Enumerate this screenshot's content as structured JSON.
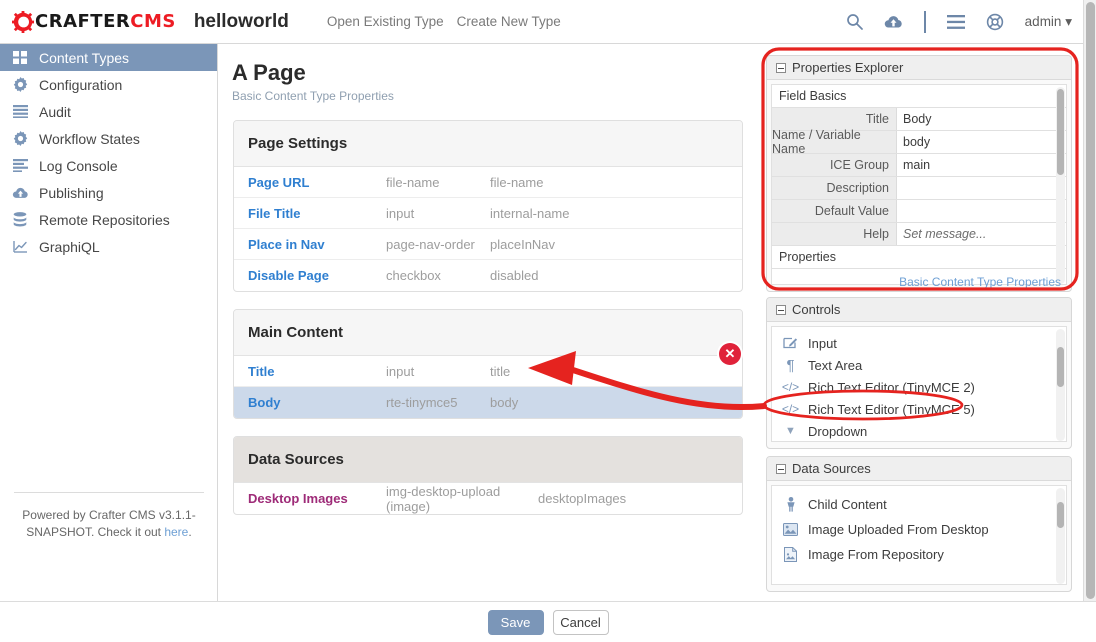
{
  "header": {
    "logo_text_1": "CRAFTER",
    "logo_text_2": "CMS",
    "site_name": "helloworld",
    "links": [
      {
        "label": "Open Existing Type"
      },
      {
        "label": "Create New Type"
      }
    ],
    "icons": [
      "search-icon",
      "cloud-upload-icon",
      "hamburger-menu-icon",
      "help-globe-icon"
    ],
    "user_menu": "admin"
  },
  "sidebar": {
    "items": [
      {
        "label": "Content Types",
        "icon": "grid-icon",
        "active": true
      },
      {
        "label": "Configuration",
        "icon": "gear-icon",
        "active": false
      },
      {
        "label": "Audit",
        "icon": "lines-icon",
        "active": false
      },
      {
        "label": "Workflow States",
        "icon": "gear-icon",
        "active": false
      },
      {
        "label": "Log Console",
        "icon": "log-lines-icon",
        "active": false
      },
      {
        "label": "Publishing",
        "icon": "cloud-upload-icon",
        "active": false
      },
      {
        "label": "Remote Repositories",
        "icon": "database-icon",
        "active": false
      },
      {
        "label": "GraphiQL",
        "icon": "chart-line-icon",
        "active": false
      }
    ],
    "footer": {
      "text_1": "Powered by Crafter CMS v3.1.1-SNAPSHOT. Check it out ",
      "link": "here",
      "text_2": "."
    }
  },
  "main": {
    "title": "A Page",
    "subtitle": "Basic Content Type Properties",
    "sections": [
      {
        "heading": "Page Settings",
        "style": "light",
        "rows": [
          {
            "name": "Page URL",
            "type": "file-name",
            "variable": "file-name",
            "selected": false,
            "color": "blue"
          },
          {
            "name": "File Title",
            "type": "input",
            "variable": "internal-name",
            "selected": false,
            "color": "blue"
          },
          {
            "name": "Place in Nav",
            "type": "page-nav-order",
            "variable": "placeInNav",
            "selected": false,
            "color": "blue"
          },
          {
            "name": "Disable Page",
            "type": "checkbox",
            "variable": "disabled",
            "selected": false,
            "color": "blue"
          }
        ]
      },
      {
        "heading": "Main Content",
        "style": "light",
        "rows": [
          {
            "name": "Title",
            "type": "input",
            "variable": "title",
            "selected": false,
            "color": "blue"
          },
          {
            "name": "Body",
            "type": "rte-tinymce5",
            "variable": "body",
            "selected": true,
            "color": "blue"
          }
        ]
      },
      {
        "heading": "Data Sources",
        "style": "alt",
        "rows": [
          {
            "name": "Desktop Images",
            "type": "img-desktop-upload (image)",
            "variable": "desktopImages",
            "selected": false,
            "color": "purple"
          }
        ]
      }
    ]
  },
  "right": {
    "properties_explorer": {
      "title": "Properties Explorer",
      "section_1": "Field Basics",
      "fields": [
        {
          "key": "Title",
          "value": "Body",
          "placeholder": false
        },
        {
          "key": "Name / Variable Name",
          "value": "body",
          "placeholder": false
        },
        {
          "key": "ICE Group",
          "value": "main",
          "placeholder": false
        },
        {
          "key": "Description",
          "value": "",
          "placeholder": false
        },
        {
          "key": "Default Value",
          "value": "",
          "placeholder": false
        },
        {
          "key": "Help",
          "value": "Set message...",
          "placeholder": true
        }
      ],
      "section_2": "Properties",
      "footer_link": "Basic Content Type Properties"
    },
    "controls": {
      "title": "Controls",
      "items": [
        {
          "label": "Input",
          "icon": "input-pencil-icon",
          "highlighted": false
        },
        {
          "label": "Text Area",
          "icon": "paragraph-icon",
          "highlighted": false
        },
        {
          "label": "Rich Text Editor (TinyMCE 2)",
          "icon": "code-brackets-icon",
          "highlighted": false
        },
        {
          "label": "Rich Text Editor (TinyMCE 5)",
          "icon": "code-brackets-icon",
          "highlighted": true
        },
        {
          "label": "Dropdown",
          "icon": "caret-down-icon",
          "highlighted": false
        }
      ]
    },
    "data_sources": {
      "title": "Data Sources",
      "items": [
        {
          "label": "Child Content",
          "icon": "child-content-icon"
        },
        {
          "label": "Image Uploaded From Desktop",
          "icon": "image-upload-icon"
        },
        {
          "label": "Image From Repository",
          "icon": "image-repo-icon"
        }
      ]
    }
  },
  "bottom_bar": {
    "save_label": "Save",
    "cancel_label": "Cancel"
  },
  "annotations": {
    "delete_icon": "✕",
    "accent_red": "#e5231f",
    "highlight_blue": "#ccd9ea",
    "brand_blue": "#7b96b8"
  }
}
